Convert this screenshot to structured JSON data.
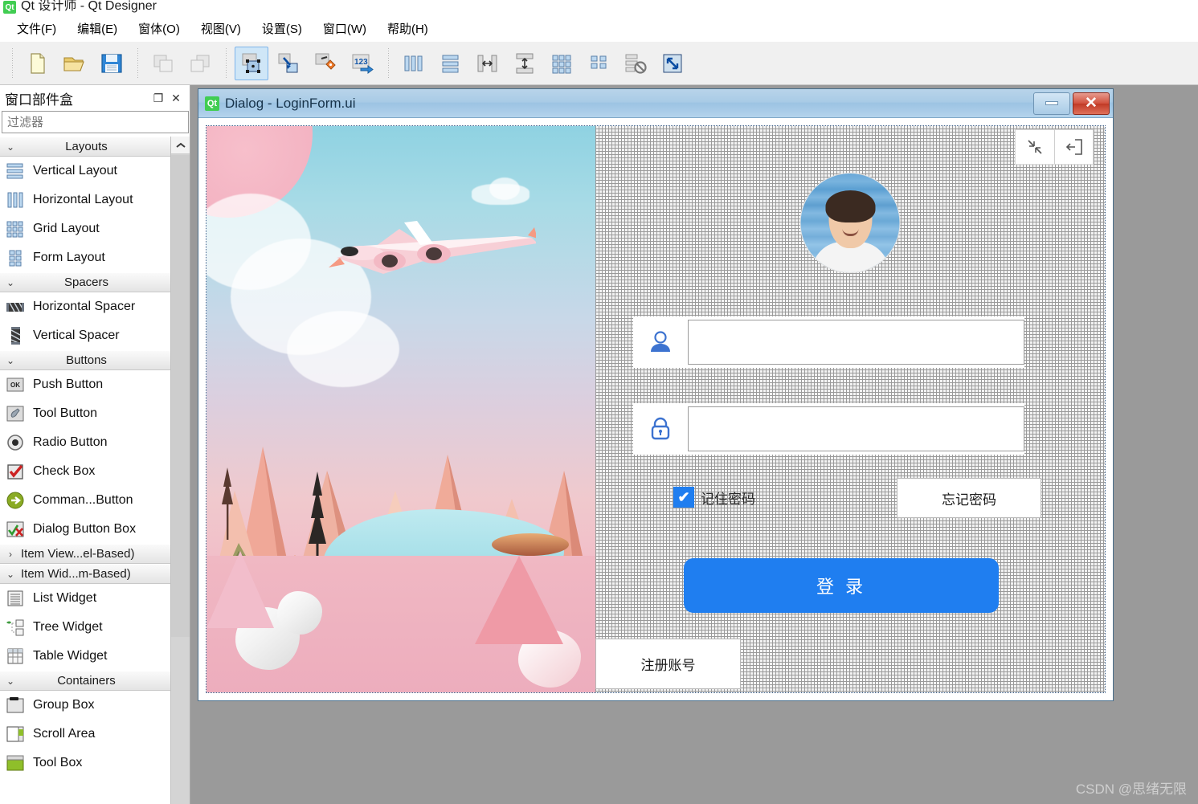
{
  "app": {
    "title": "Qt 设计师 - Qt Designer",
    "logo_text": "Qt",
    "accent": "#1f7ef0",
    "qt_green": "#41cd52"
  },
  "menubar": {
    "items": [
      {
        "label": "文件(F)",
        "name": "menu-file"
      },
      {
        "label": "编辑(E)",
        "name": "menu-edit"
      },
      {
        "label": "窗体(O)",
        "name": "menu-form"
      },
      {
        "label": "视图(V)",
        "name": "menu-view"
      },
      {
        "label": "设置(S)",
        "name": "menu-settings"
      },
      {
        "label": "窗口(W)",
        "name": "menu-window"
      },
      {
        "label": "帮助(H)",
        "name": "menu-help"
      }
    ]
  },
  "toolbar": {
    "groups": [
      [
        "new-file-icon",
        "open-folder-icon",
        "save-icon"
      ],
      [
        "undo-icon",
        "redo-icon"
      ],
      [
        "edit-widgets-icon",
        "edit-signals-slots-icon",
        "edit-buddies-icon",
        "edit-tab-order-icon"
      ],
      [
        "layout-horizontal-icon",
        "layout-vertical-icon",
        "layout-splitter-horizontal-icon",
        "layout-splitter-vertical-icon",
        "layout-grid-icon",
        "layout-form-icon",
        "break-layout-icon",
        "adjust-size-icon"
      ]
    ],
    "active_tool": "edit-widgets-icon"
  },
  "widget_box": {
    "title": "窗口部件盒",
    "restore_label": "❐",
    "close_label": "✕",
    "filter_placeholder": "过滤器",
    "filter_value": "",
    "groups": [
      {
        "label": "Layouts",
        "expanded": true,
        "items": [
          {
            "label": "Vertical Layout",
            "icon": "vertical-layout-icon"
          },
          {
            "label": "Horizontal Layout",
            "icon": "horizontal-layout-icon"
          },
          {
            "label": "Grid Layout",
            "icon": "grid-layout-icon"
          },
          {
            "label": "Form Layout",
            "icon": "form-layout-icon"
          }
        ]
      },
      {
        "label": "Spacers",
        "expanded": true,
        "items": [
          {
            "label": "Horizontal Spacer",
            "icon": "horizontal-spacer-icon"
          },
          {
            "label": "Vertical Spacer",
            "icon": "vertical-spacer-icon"
          }
        ]
      },
      {
        "label": "Buttons",
        "expanded": true,
        "items": [
          {
            "label": "Push Button",
            "icon": "push-button-icon"
          },
          {
            "label": "Tool Button",
            "icon": "tool-button-icon"
          },
          {
            "label": "Radio Button",
            "icon": "radio-button-icon"
          },
          {
            "label": "Check Box",
            "icon": "check-box-icon"
          },
          {
            "label": "Comman...Button",
            "icon": "command-link-button-icon"
          },
          {
            "label": "Dialog Button Box",
            "icon": "dialog-button-box-icon"
          }
        ]
      },
      {
        "label": "Item View...el-Based)",
        "expanded": false,
        "items": []
      },
      {
        "label": "Item Wid...m-Based)",
        "expanded": true,
        "items": [
          {
            "label": "List Widget",
            "icon": "list-widget-icon"
          },
          {
            "label": "Tree Widget",
            "icon": "tree-widget-icon"
          },
          {
            "label": "Table Widget",
            "icon": "table-widget-icon"
          }
        ]
      },
      {
        "label": "Containers",
        "expanded": true,
        "items": [
          {
            "label": "Group Box",
            "icon": "group-box-icon"
          },
          {
            "label": "Scroll Area",
            "icon": "scroll-area-icon"
          },
          {
            "label": "Tool Box",
            "icon": "tool-box-icon"
          }
        ]
      }
    ]
  },
  "dialog": {
    "title": "Dialog - LoginForm.ui",
    "logo_text": "Qt",
    "minimize_label": "",
    "close_label": "✕"
  },
  "login_form": {
    "top_buttons": [
      {
        "name": "minimize-window-icon",
        "label": ""
      },
      {
        "name": "exit-app-icon",
        "label": ""
      }
    ],
    "avatar_alt": "user-avatar",
    "username": {
      "icon": "user-icon",
      "value": "",
      "placeholder": ""
    },
    "password": {
      "icon": "lock-icon",
      "value": "",
      "placeholder": ""
    },
    "remember": {
      "label": "记住密码",
      "checked": true,
      "check_glyph": "✔"
    },
    "forgot_button": "忘记密码",
    "login_button": "登 录",
    "register_button": "注册账号"
  },
  "watermark": "CSDN @思绪无限"
}
